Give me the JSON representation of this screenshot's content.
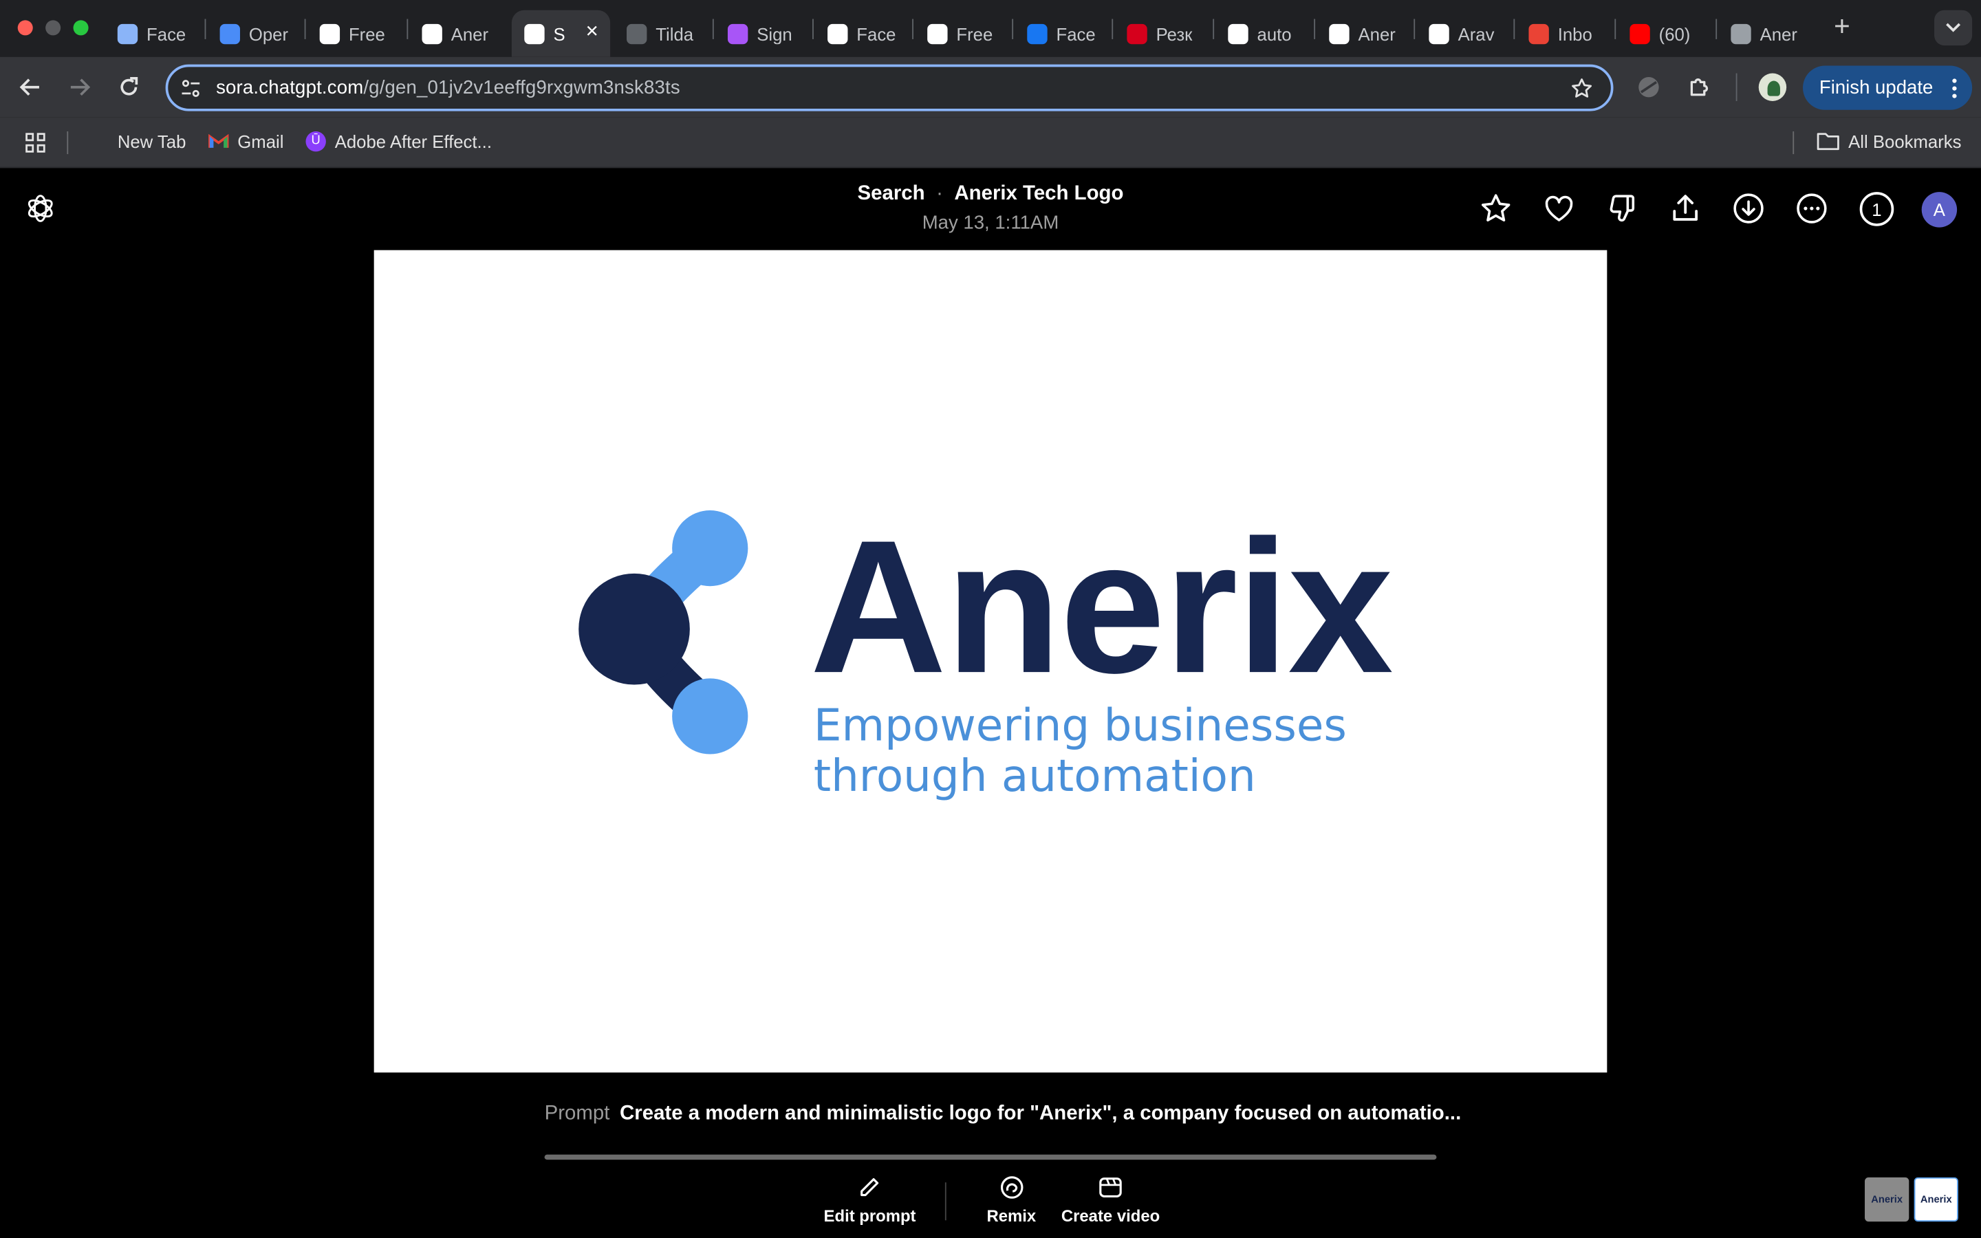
{
  "tabs": [
    {
      "title": "Face",
      "icon": "person-icon",
      "color": "#8ab4f8"
    },
    {
      "title": "Oper",
      "icon": "openai-icon",
      "color": "#4a8cf7"
    },
    {
      "title": "Free",
      "icon": "pen-icon",
      "color": "#ffffff"
    },
    {
      "title": "Aner",
      "icon": "openai-icon",
      "color": "#ffffff"
    },
    {
      "title": "S",
      "icon": "sora-icon",
      "color": "#ffffff"
    },
    {
      "title": "Tilda",
      "icon": "tilda-icon",
      "color": "#5f6368"
    },
    {
      "title": "Sign",
      "icon": "make-icon",
      "color": "#a855f7"
    },
    {
      "title": "Face",
      "icon": "grid-icon",
      "color": "#ffffff"
    },
    {
      "title": "Free",
      "icon": "pen-icon",
      "color": "#ffffff"
    },
    {
      "title": "Face",
      "icon": "facebook-icon",
      "color": "#1877f2"
    },
    {
      "title": "Резк",
      "icon": "hh-icon",
      "color": "#d6001c"
    },
    {
      "title": "auto",
      "icon": "google-icon",
      "color": "#ffffff"
    },
    {
      "title": "Aner",
      "icon": "google-icon",
      "color": "#ffffff"
    },
    {
      "title": "Arav",
      "icon": "google-icon",
      "color": "#ffffff"
    },
    {
      "title": "Inbo",
      "icon": "gmail-icon",
      "color": "#ea4335"
    },
    {
      "title": "(60)",
      "icon": "youtube-icon",
      "color": "#ff0000"
    },
    {
      "title": "Aner",
      "icon": "globe-icon",
      "color": "#9aa0a6"
    }
  ],
  "active_tab_index": 4,
  "address": {
    "host": "sora.chatgpt.com",
    "path": "/g/gen_01jv2v1eeffg9rxgwm3nsk83ts"
  },
  "finish_update_label": "Finish update",
  "bookmarks": {
    "items": [
      {
        "label": "New Tab",
        "icon": ""
      },
      {
        "label": "Gmail",
        "icon": "gmail-icon"
      },
      {
        "label": "Adobe After Effect...",
        "icon": "adobe-icon"
      }
    ],
    "all_label": "All Bookmarks"
  },
  "header": {
    "breadcrumb_root": "Search",
    "breadcrumb_title": "Anerix Tech Logo",
    "date": "May 13, 1:11AM",
    "count": "1",
    "avatar_initial": "A"
  },
  "image": {
    "wordmark": "Anerix",
    "tagline_line1": "Empowering businesses",
    "tagline_line2": "through automation",
    "colors": {
      "navy": "#17264f",
      "blue": "#5aa2f0",
      "tagline": "#4a90d9"
    }
  },
  "prompt": {
    "label": "Prompt",
    "text": "Create a modern and minimalistic logo for \"Anerix\", a company focused on automatio..."
  },
  "progress": 1.0,
  "actions": {
    "edit_label": "Edit prompt",
    "remix_label": "Remix",
    "create_label": "Create video"
  },
  "thumbnails": [
    "Anerix",
    "Anerix"
  ]
}
